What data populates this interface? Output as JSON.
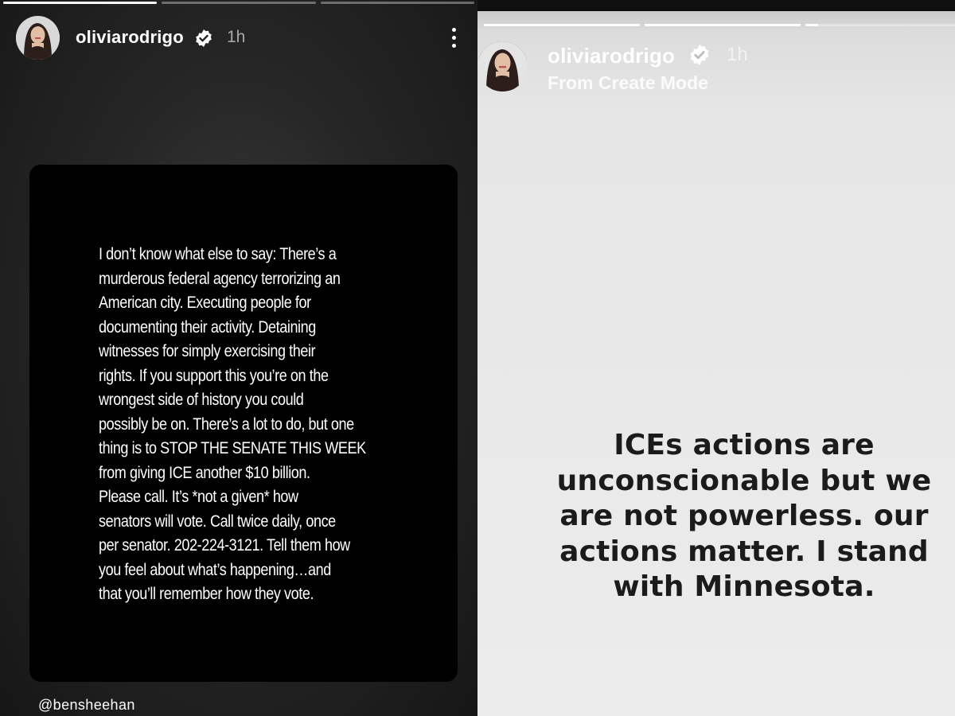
{
  "left_story": {
    "progress": [
      1.0,
      0,
      0
    ],
    "username": "oliviarodrigo",
    "time": "1h",
    "post_text": "I don’t know what else to say: There’s a\nmurderous federal agency terrorizing an\nAmerican city. Executing people for\ndocumenting their activity. Detaining\nwitnesses for simply exercising their\nrights. If you support this you’re on the\nwrongest side of history you could\npossibly be on. There’s a lot to do, but one\nthing is to STOP THE SENATE THIS WEEK\nfrom giving ICE another $10 billion.\nPlease call. It’s *not a given* how\nsenators will vote. Call twice daily, once\nper senator. 202-224-3121. Tell them how\nyou feel about what’s happening…and\nthat you’ll remember how they vote.",
    "mention": "@bensheehan",
    "icons": [
      "verified-badge-icon",
      "more-options-icon"
    ]
  },
  "right_story": {
    "progress": [
      1.0,
      1.0,
      0.08
    ],
    "username": "oliviarodrigo",
    "time": "1h",
    "subtitle": "From Create Mode",
    "message": "ICEs actions are\nunconscionable but we\nare not powerless. our\nactions matter. I stand\nwith Minnesota."
  },
  "colors": {
    "left_background": "#262626",
    "card_background": "#000000",
    "right_background": "#e6e6e6",
    "message_text": "#1b1b1b",
    "text_light": "#ffffff"
  }
}
